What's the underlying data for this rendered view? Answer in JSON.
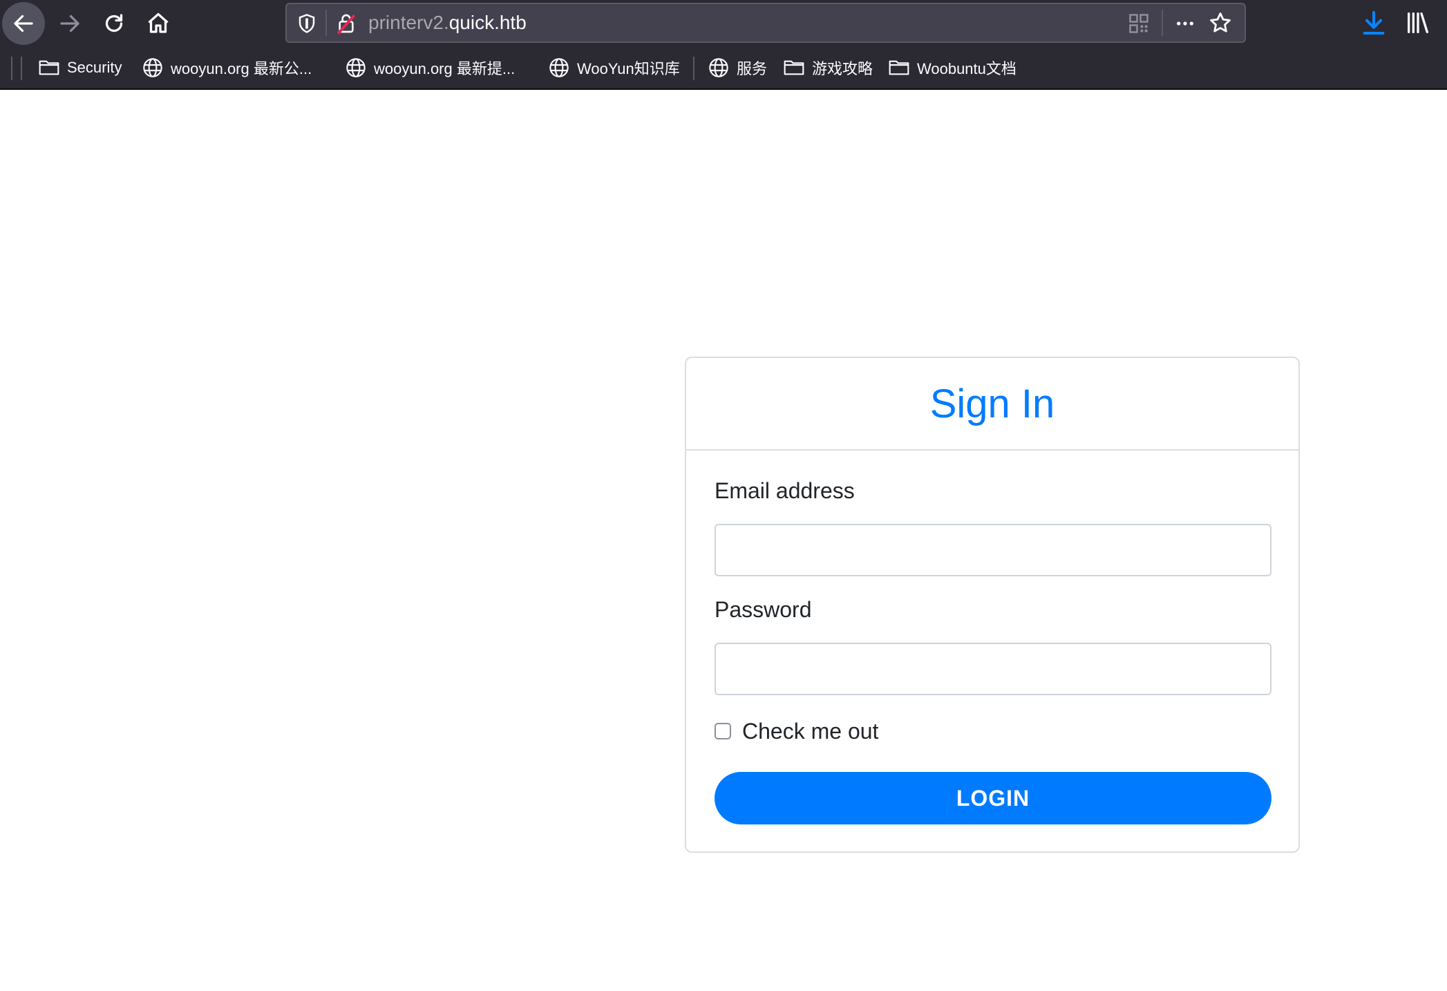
{
  "browser": {
    "url_prefix": "printerv2.",
    "url_domain": "quick.htb",
    "icons": [
      "back-arrow-icon",
      "forward-arrow-icon",
      "reload-icon",
      "home-icon",
      "shield-icon",
      "insecure-lock-icon",
      "qr-code-icon",
      "more-icon",
      "bookmark-star-icon",
      "download-icon",
      "library-icon"
    ],
    "accent_color": "#0a84ff"
  },
  "bookmarks": [
    {
      "label": "Security",
      "icon": "folder-icon"
    },
    {
      "label": "wooyun.org 最新公...",
      "icon": "globe-icon"
    },
    {
      "label": "wooyun.org 最新提...",
      "icon": "globe-icon"
    },
    {
      "label": "WooYun知识库",
      "icon": "globe-icon"
    },
    {
      "label": "服务",
      "icon": "globe-icon"
    },
    {
      "label": "游戏攻略",
      "icon": "folder-icon"
    },
    {
      "label": "Woobuntu文档",
      "icon": "folder-icon"
    }
  ],
  "form": {
    "title": "Sign In",
    "email_label": "Email address",
    "email_value": "",
    "password_label": "Password",
    "password_value": "",
    "checkbox_label": "Check me out",
    "checkbox_checked": false,
    "submit_label": "LOGIN",
    "primary_color": "#007bff"
  }
}
